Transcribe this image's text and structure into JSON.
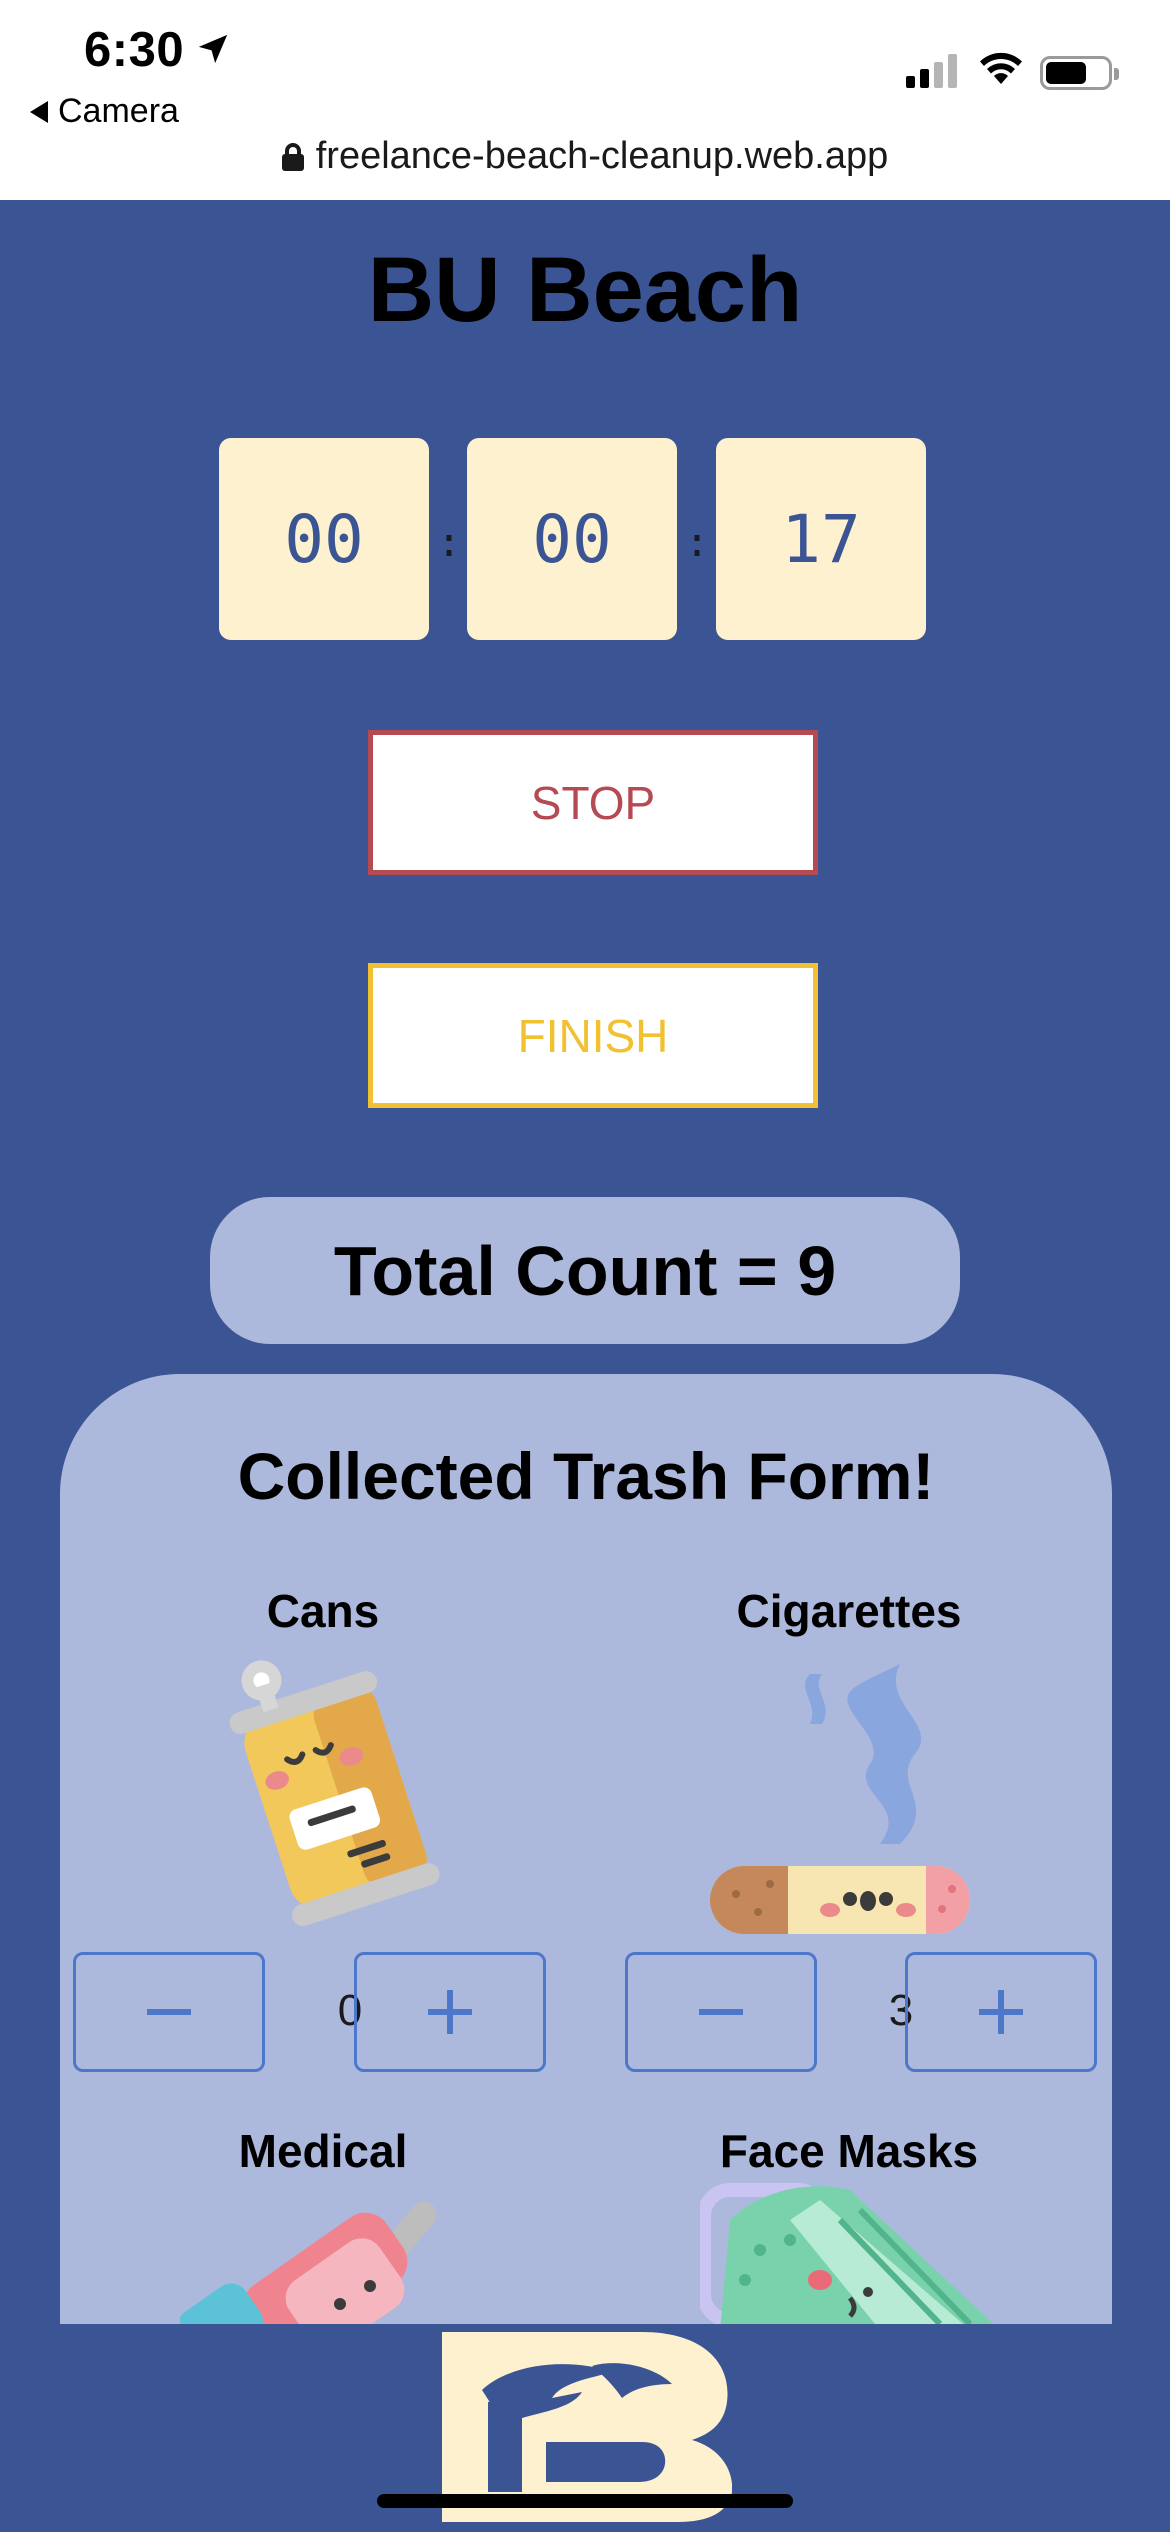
{
  "status_bar": {
    "time": "6:30",
    "back_app": "Camera",
    "url": "freelance-beach-cleanup.web.app"
  },
  "page": {
    "title": "BU Beach"
  },
  "timer": {
    "hours": "00",
    "minutes": "00",
    "seconds": "17",
    "separator": ":"
  },
  "buttons": {
    "stop": "STOP",
    "finish": "FINISH"
  },
  "total": {
    "label": "Total Count = 9"
  },
  "form": {
    "title": "Collected Trash Form!",
    "items": [
      {
        "label": "Cans",
        "count": "0",
        "minus": "−",
        "plus": "+"
      },
      {
        "label": "Cigarettes",
        "count": "3",
        "minus": "−",
        "plus": "+"
      },
      {
        "label": "Medical"
      },
      {
        "label": "Face Masks"
      }
    ]
  },
  "colors": {
    "background": "#3b5494",
    "panel": "#adb8dd",
    "timer_box": "#fdf1cf",
    "stop": "#b54a52",
    "finish": "#f2c132",
    "stepper": "#4d78c9"
  },
  "icons": [
    "location-arrow-icon",
    "signal-icon",
    "wifi-icon",
    "battery-icon",
    "lock-icon",
    "can-illustration",
    "cigarette-illustration",
    "medical-illustration",
    "face-mask-illustration",
    "bu-logo"
  ]
}
